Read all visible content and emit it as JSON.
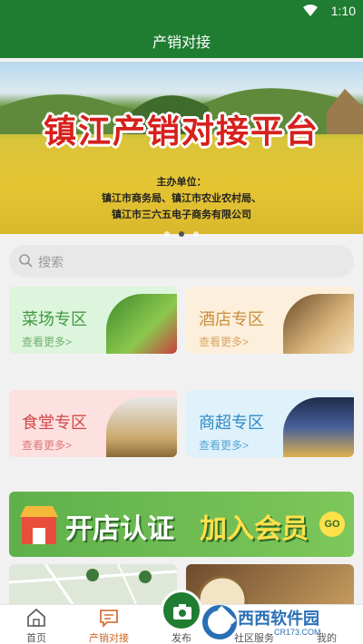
{
  "status_bar": {
    "time": "1:10"
  },
  "app_bar": {
    "title": "产销对接"
  },
  "banner": {
    "title": "镇江产销对接平台",
    "organizer_label": "主办单位：",
    "organizer_line1": "镇江市商务局、镇江市农业农村局、",
    "organizer_line2": "镇江市三六五电子商务有限公司",
    "active_slide": 2,
    "slide_count": 3
  },
  "search": {
    "placeholder": "搜索"
  },
  "zones": [
    {
      "title": "菜场专区",
      "more": "查看更多>"
    },
    {
      "title": "酒店专区",
      "more": "查看更多>"
    },
    {
      "title": "食堂专区",
      "more": "查看更多>"
    },
    {
      "title": "商超专区",
      "more": "查看更多>"
    }
  ],
  "promo": {
    "left_text": "开店认证",
    "right_text": "加入会员",
    "go": "GO"
  },
  "bottom_nav": {
    "items": [
      {
        "label": "首页",
        "icon": "home-icon"
      },
      {
        "label": "产销对接",
        "icon": "chat-icon"
      },
      {
        "label": "发布",
        "icon": "camera-icon"
      },
      {
        "label": "社区服务",
        "icon": "community-icon"
      },
      {
        "label": "我的",
        "icon": "user-icon"
      }
    ],
    "active_index": 1
  },
  "watermark": {
    "text": "西西软件园",
    "url_text": "CR173.COM"
  }
}
